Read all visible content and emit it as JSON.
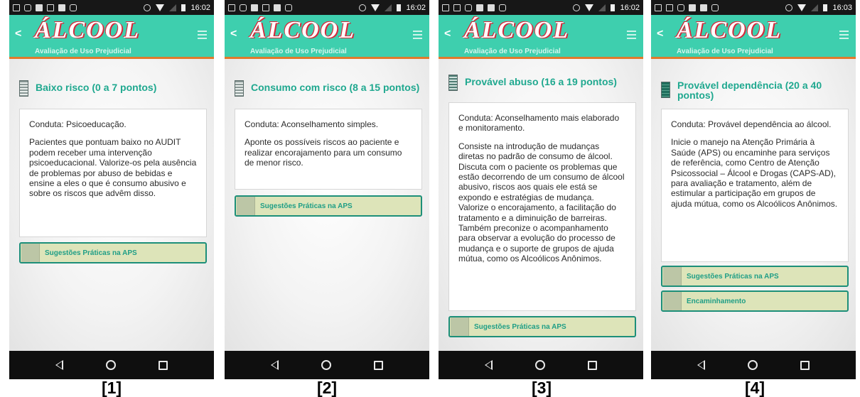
{
  "app": {
    "logo": "ÁLCOOL",
    "subtitle": "Avaliação de Uso Prejudicial"
  },
  "colors": {
    "appbar": "#3ecfae",
    "accent_line": "#e07a2c",
    "heading": "#1fa88f",
    "button_bg": "#dde4b9",
    "button_border": "#1d8f79"
  },
  "screens": [
    {
      "caption": "[1]",
      "status_time": "16:02",
      "heading": "Baixo risco (0 a 7 pontos)",
      "level_icon": "level-1-icon",
      "paragraphs": [
        "Conduta: Psicoeducação.",
        "Pacientes que pontuam baixo no AUDIT podem receber uma intervenção psicoeducacional. Valorize-os pela ausência de problemas por abuso de bebidas e ensine a eles o que é consumo abusivo e sobre os riscos que advêm disso."
      ],
      "buttons": [
        "Sugestões Práticas na APS"
      ]
    },
    {
      "caption": "[2]",
      "status_time": "16:02",
      "heading": "Consumo com risco (8 a 15 pontos)",
      "level_icon": "level-2-icon",
      "paragraphs": [
        "Conduta: Aconselhamento simples.",
        "Aponte os possíveis riscos ao paciente e realizar encorajamento para um consumo de menor risco."
      ],
      "buttons": [
        "Sugestões Práticas na APS"
      ]
    },
    {
      "caption": "[3]",
      "status_time": "16:02",
      "heading": "Provável abuso (16 a 19 pontos)",
      "level_icon": "level-3-icon",
      "paragraphs": [
        "Conduta: Aconselhamento mais elaborado e monitoramento.",
        "Consiste na introdução de mudanças diretas no padrão de consumo de álcool. Discuta com o paciente os problemas que estão decorrendo de um consumo de álcool abusivo, riscos aos quais ele está se expondo e estratégias de mudança. Valorize o encorajamento, a facilitação do tratamento e a diminuição de barreiras. Também preconize o acompanhamento para observar a evolução do processo de mudança e o suporte de grupos de ajuda mútua, como os Alcoólicos Anônimos."
      ],
      "buttons": [
        "Sugestões Práticas na APS"
      ]
    },
    {
      "caption": "[4]",
      "status_time": "16:03",
      "heading": "Provável dependência (20 a 40 pontos)",
      "level_icon": "level-4-icon",
      "paragraphs": [
        "Conduta: Provável dependência ao álcool.",
        "Inicie o manejo na Atenção Primária à Saúde (APS) ou encaminhe para serviços de referência, como Centro de Atenção Psicossocial – Álcool e Drogas (CAPS-AD), para avaliação e tratamento, além de estimular a participação em grupos de ajuda mútua, como os Alcoólicos Anônimos."
      ],
      "buttons": [
        "Sugestões Práticas na APS",
        "Encaminhamento"
      ]
    }
  ]
}
